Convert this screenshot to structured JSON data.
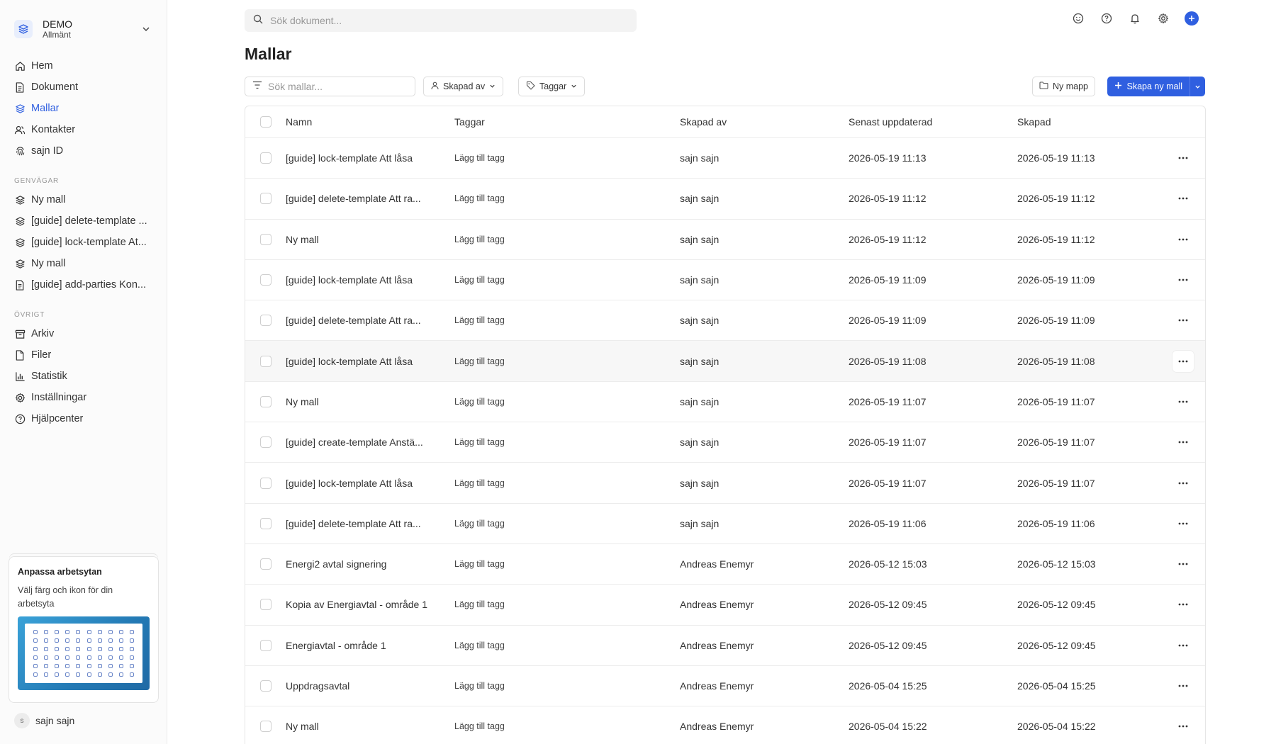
{
  "workspace": {
    "name": "DEMO",
    "sub": "Allmänt"
  },
  "nav": [
    {
      "label": "Hem",
      "icon": "home-icon",
      "active": false
    },
    {
      "label": "Dokument",
      "icon": "document-icon",
      "active": false
    },
    {
      "label": "Mallar",
      "icon": "layers-icon",
      "active": true
    },
    {
      "label": "Kontakter",
      "icon": "contacts-icon",
      "active": false
    },
    {
      "label": "sajn ID",
      "icon": "fingerprint-icon",
      "active": false
    }
  ],
  "shortcuts": {
    "title": "GENVÄGAR",
    "items": [
      {
        "label": "Ny mall",
        "icon": "layers-icon"
      },
      {
        "label": "[guide] delete-template ...",
        "icon": "layers-icon"
      },
      {
        "label": "[guide] lock-template At...",
        "icon": "layers-icon"
      },
      {
        "label": "Ny mall",
        "icon": "layers-icon"
      },
      {
        "label": "[guide] add-parties Kon...",
        "icon": "document-icon"
      }
    ]
  },
  "other": {
    "title": "ÖVRIGT",
    "items": [
      {
        "label": "Arkiv",
        "icon": "archive-icon"
      },
      {
        "label": "Filer",
        "icon": "file-icon"
      },
      {
        "label": "Statistik",
        "icon": "chart-icon"
      },
      {
        "label": "Inställningar",
        "icon": "gear-icon"
      },
      {
        "label": "Hjälpcenter",
        "icon": "help-icon"
      }
    ]
  },
  "promo": {
    "title": "Anpassa arbetsytan",
    "text": "Välj färg och ikon för din arbetsyta"
  },
  "user": {
    "initial": "s",
    "name": "sajn sajn"
  },
  "search": {
    "placeholder": "Sök dokument..."
  },
  "page": {
    "title": "Mallar"
  },
  "toolbar": {
    "filter_placeholder": "Sök mallar...",
    "created_by": "Skapad av",
    "tags": "Taggar",
    "new_folder": "Ny mapp",
    "create": "Skapa ny mall"
  },
  "table": {
    "headers": {
      "name": "Namn",
      "tags": "Taggar",
      "by": "Skapad av",
      "updated": "Senast uppdaterad",
      "created": "Skapad"
    },
    "rows": [
      {
        "name": "[guide] lock-template Att låsa",
        "tags": "Lägg till tagg",
        "by": "sajn sajn",
        "updated": "2026-05-19 11:13",
        "created": "2026-05-19 11:13"
      },
      {
        "name": "[guide] delete-template Att ra...",
        "tags": "Lägg till tagg",
        "by": "sajn sajn",
        "updated": "2026-05-19 11:12",
        "created": "2026-05-19 11:12"
      },
      {
        "name": "Ny mall",
        "tags": "Lägg till tagg",
        "by": "sajn sajn",
        "updated": "2026-05-19 11:12",
        "created": "2026-05-19 11:12"
      },
      {
        "name": "[guide] lock-template Att låsa",
        "tags": "Lägg till tagg",
        "by": "sajn sajn",
        "updated": "2026-05-19 11:09",
        "created": "2026-05-19 11:09"
      },
      {
        "name": "[guide] delete-template Att ra...",
        "tags": "Lägg till tagg",
        "by": "sajn sajn",
        "updated": "2026-05-19 11:09",
        "created": "2026-05-19 11:09"
      },
      {
        "name": "[guide] lock-template Att låsa",
        "tags": "Lägg till tagg",
        "by": "sajn sajn",
        "updated": "2026-05-19 11:08",
        "created": "2026-05-19 11:08"
      },
      {
        "name": "Ny mall",
        "tags": "Lägg till tagg",
        "by": "sajn sajn",
        "updated": "2026-05-19 11:07",
        "created": "2026-05-19 11:07"
      },
      {
        "name": "[guide] create-template Anstä...",
        "tags": "Lägg till tagg",
        "by": "sajn sajn",
        "updated": "2026-05-19 11:07",
        "created": "2026-05-19 11:07"
      },
      {
        "name": "[guide] lock-template Att låsa",
        "tags": "Lägg till tagg",
        "by": "sajn sajn",
        "updated": "2026-05-19 11:07",
        "created": "2026-05-19 11:07"
      },
      {
        "name": "[guide] delete-template Att ra...",
        "tags": "Lägg till tagg",
        "by": "sajn sajn",
        "updated": "2026-05-19 11:06",
        "created": "2026-05-19 11:06"
      },
      {
        "name": "Energi2 avtal signering",
        "tags": "Lägg till tagg",
        "by": "Andreas Enemyr",
        "updated": "2026-05-12 15:03",
        "created": "2026-05-12 15:03"
      },
      {
        "name": "Kopia av Energiavtal - område 1",
        "tags": "Lägg till tagg",
        "by": "Andreas Enemyr",
        "updated": "2026-05-12 09:45",
        "created": "2026-05-12 09:45"
      },
      {
        "name": "Energiavtal - område 1",
        "tags": "Lägg till tagg",
        "by": "Andreas Enemyr",
        "updated": "2026-05-12 09:45",
        "created": "2026-05-12 09:45"
      },
      {
        "name": "Uppdragsavtal",
        "tags": "Lägg till tagg",
        "by": "Andreas Enemyr",
        "updated": "2026-05-04 15:25",
        "created": "2026-05-04 15:25"
      },
      {
        "name": "Ny mall",
        "tags": "Lägg till tagg",
        "by": "Andreas Enemyr",
        "updated": "2026-05-04 15:22",
        "created": "2026-05-04 15:22"
      }
    ]
  },
  "colors": {
    "accent": "#2f5fe0"
  }
}
